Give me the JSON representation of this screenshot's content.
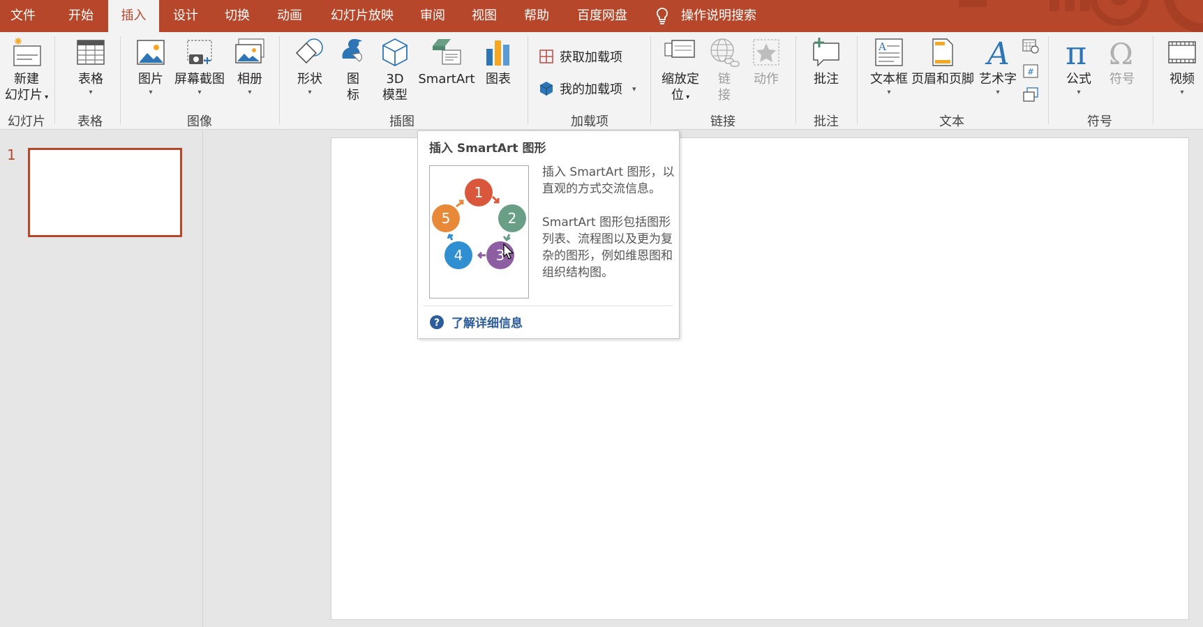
{
  "tabs": [
    "文件",
    "开始",
    "插入",
    "设计",
    "切换",
    "动画",
    "幻灯片放映",
    "审阅",
    "视图",
    "帮助",
    "百度网盘"
  ],
  "active_tab": "插入",
  "tell_me": "操作说明搜索",
  "ribbon": {
    "slides": {
      "new_slide_l1": "新建",
      "new_slide_l2": "幻灯片",
      "group": "幻灯片"
    },
    "tables": {
      "table": "表格",
      "group": "表格"
    },
    "images": {
      "pictures": "图片",
      "screenshot": "屏幕截图",
      "album": "相册",
      "group": "图像"
    },
    "illustrations": {
      "shapes": "形状",
      "icons_l1": "图",
      "icons_l2": "标",
      "model_l1": "3D",
      "model_l2": "模型",
      "smartart": "SmartArt",
      "chart": "图表",
      "group": "插图"
    },
    "addins": {
      "get": "获取加载项",
      "mine": "我的加载项",
      "group": "加载项"
    },
    "links": {
      "zoom_l1": "缩放定",
      "zoom_l2": "位",
      "link_l1": "链",
      "link_l2": "接",
      "action": "动作",
      "group": "链接"
    },
    "comments": {
      "comment": "批注",
      "group": "批注"
    },
    "text": {
      "textbox": "文本框",
      "header_footer": "页眉和页脚",
      "wordart": "艺术字",
      "group": "文本"
    },
    "symbols": {
      "equation": "公式",
      "symbol": "符号",
      "group": "符号"
    },
    "media": {
      "video": "视频"
    }
  },
  "slides_panel": {
    "slide_number": "1"
  },
  "tooltip": {
    "title": "插入 SmartArt 图形",
    "desc1": "插入 SmartArt 图形，以直观的方式交流信息。",
    "desc2": "SmartArt 图形包括图形列表、流程图以及更为复杂的图形，例如维恩图和组织结构图。",
    "link": "了解详细信息",
    "circles": [
      "1",
      "2",
      "3",
      "4",
      "5"
    ]
  },
  "colors": {
    "accent": "#b7472a",
    "ribbon_bg": "#f3f3f3",
    "link": "#2c5d9a"
  }
}
